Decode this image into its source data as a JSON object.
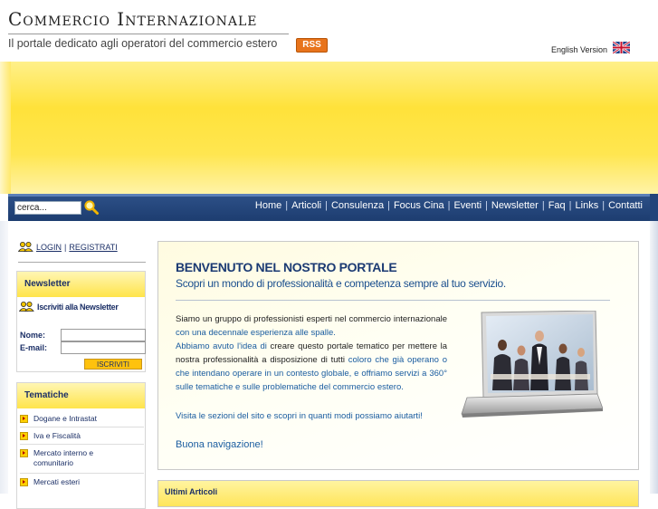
{
  "header": {
    "title": "Commercio Internazionale",
    "tagline": "Il portale dedicato agli operatori del commercio estero",
    "rss_label": "RSS",
    "english_link": "English Version"
  },
  "search": {
    "value": "cerca..."
  },
  "nav": {
    "items": [
      "Home",
      "Articoli",
      "Consulenza",
      "Focus Cina",
      "Eventi",
      "Newsletter",
      "Faq",
      "Links",
      "Contatti"
    ],
    "separator": "|"
  },
  "sidebar": {
    "login": "LOGIN",
    "separator": "|",
    "register": "REGISTRATI",
    "newsletter": {
      "title": "Newsletter",
      "subscribe_link": "Iscriviti alla Newsletter",
      "name_label": "Nome:",
      "email_label": "E-mail:",
      "button": "ISCRIVITI"
    },
    "tematiche": {
      "title": "Tematiche",
      "items": [
        "Dogane e Intrastat",
        "Iva e Fiscalità",
        "Mercato interno e comunitario",
        "Mercati esteri"
      ]
    }
  },
  "main": {
    "welcome_title": "BENVENUTO NEL NOSTRO PORTALE",
    "welcome_subtitle": "Scopri un mondo di professionalità e competenza sempre al tuo servizio.",
    "p1_a": "Siamo un gruppo di professionisti esperti nel commercio internazionale",
    "p1_b": " con una decennale esperienza alle spalle.",
    "p2_a": "Abbiamo avuto l'idea di",
    "p2_b": " creare questo portale tematico per mettere la nostra professionalità a disposizione di tutti",
    "p2_c": " coloro che già operano o che intendano operare in un contesto globale, e offriamo servizi a 360°",
    "p2_d": " sulle tematiche e sulle problematiche del commercio estero.",
    "p3": "Visita le sezioni del sito e scopri in quanti modi possiamo aiutarti!",
    "closing": "Buona navigazione!",
    "articles_title": "Ultimi Articoli"
  },
  "colors": {
    "nav_bg": "#1d3d70",
    "banner_yellow": "#ffe23a",
    "link_blue": "#1b5da0",
    "title_blue": "#1b3a73",
    "button_orange": "#ffc20e"
  }
}
